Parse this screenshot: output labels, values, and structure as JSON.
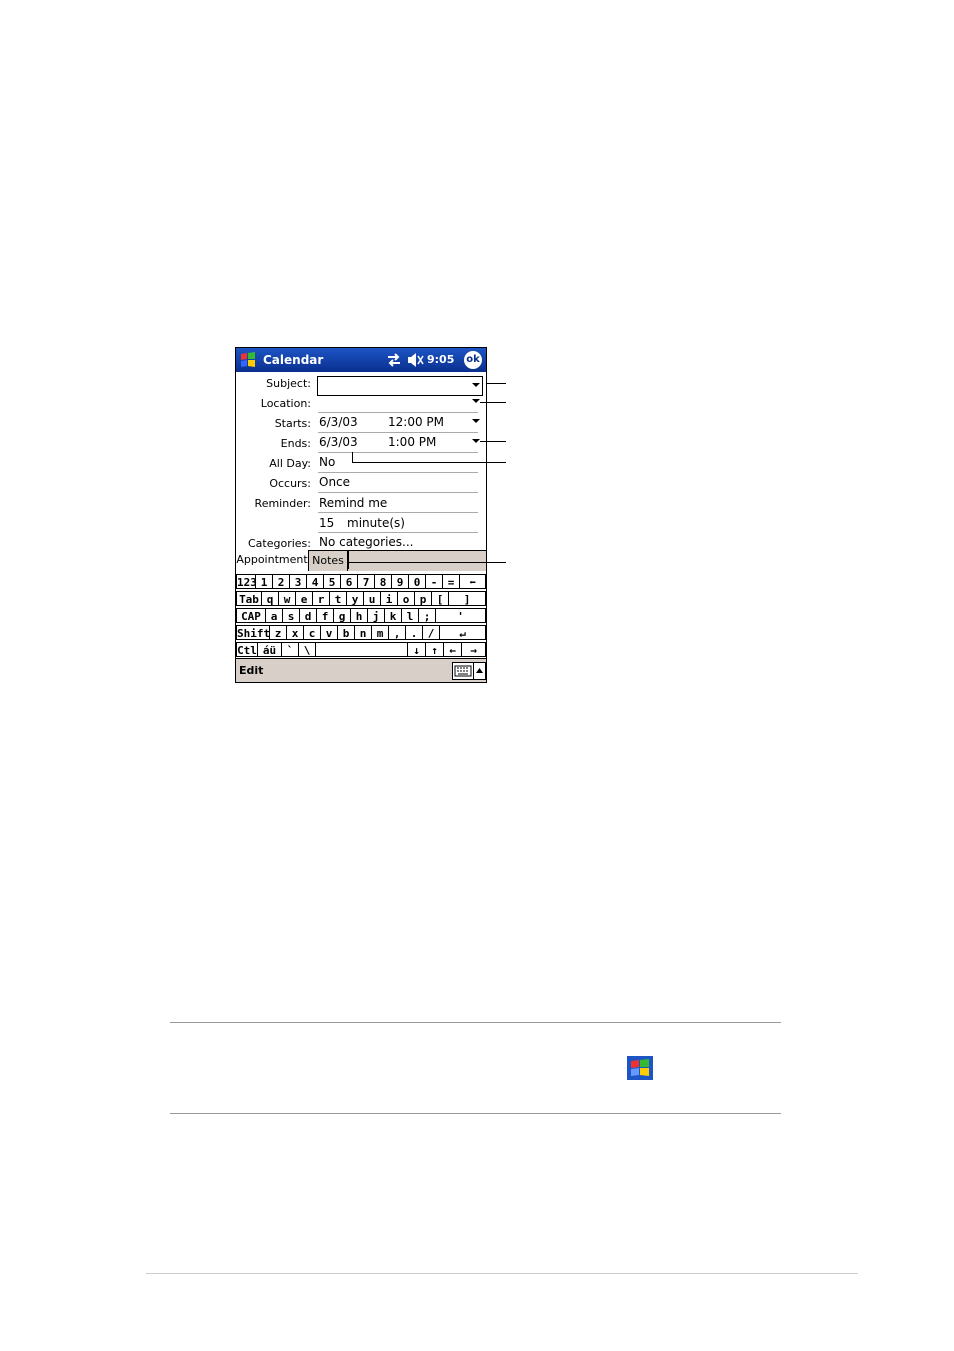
{
  "titlebar": {
    "app_name": "Calendar",
    "time": "9:05",
    "ok_label": "ok"
  },
  "form": {
    "subject_label": "Subject:",
    "subject_value": "",
    "location_label": "Location:",
    "location_value": "",
    "starts_label": "Starts:",
    "starts_date": "6/3/03",
    "starts_time": "12:00 PM",
    "ends_label": "Ends:",
    "ends_date": "6/3/03",
    "ends_time": "1:00 PM",
    "allday_label": "All Day:",
    "allday_value": "No",
    "occurs_label": "Occurs:",
    "occurs_value": "Once",
    "reminder_label": "Reminder:",
    "reminder_value": "Remind me",
    "reminder_amount": "15",
    "reminder_unit": "minute(s)",
    "categories_label": "Categories:",
    "categories_value": "No categories..."
  },
  "tabs": {
    "appointment": "Appointment",
    "notes": "Notes"
  },
  "keyboard": {
    "rows": [
      [
        "123",
        "1",
        "2",
        "3",
        "4",
        "5",
        "6",
        "7",
        "8",
        "9",
        "0",
        "-",
        "=",
        "⬅"
      ],
      [
        "Tab",
        "q",
        "w",
        "e",
        "r",
        "t",
        "y",
        "u",
        "i",
        "o",
        "p",
        "[",
        "]"
      ],
      [
        "CAP",
        "a",
        "s",
        "d",
        "f",
        "g",
        "h",
        "j",
        "k",
        "l",
        ";",
        "'"
      ],
      [
        "Shift",
        "z",
        "x",
        "c",
        "v",
        "b",
        "n",
        "m",
        ",",
        ".",
        "/",
        "↵"
      ],
      [
        "Ctl",
        "áü",
        "`",
        "\\",
        "",
        "↓",
        "↑",
        "←",
        "→"
      ]
    ]
  },
  "menubar": {
    "edit_label": "Edit"
  },
  "colors": {
    "titlebar": "#0a2f8f",
    "menubar": "#d8d0c8"
  }
}
